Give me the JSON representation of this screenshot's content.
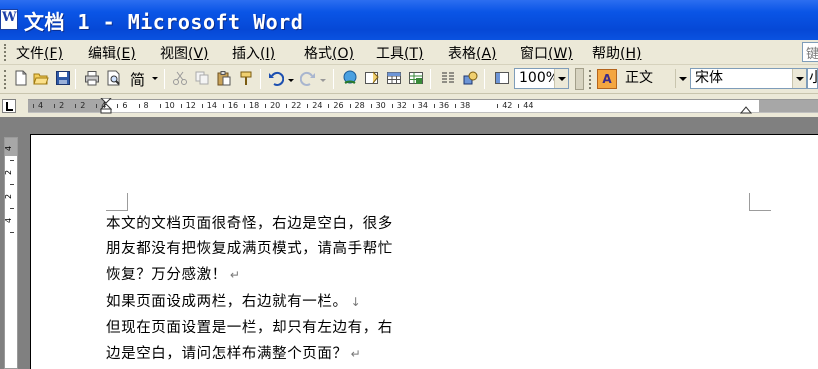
{
  "window": {
    "title": "文档 1 - Microsoft Word"
  },
  "menu": {
    "items": [
      {
        "label": "文件",
        "accel": "(F)"
      },
      {
        "label": "编辑",
        "accel": "(E)"
      },
      {
        "label": "视图",
        "accel": "(V)"
      },
      {
        "label": "插入",
        "accel": "(I)"
      },
      {
        "label": "格式",
        "accel": "(O)"
      },
      {
        "label": "工具",
        "accel": "(T)"
      },
      {
        "label": "表格",
        "accel": "(A)"
      },
      {
        "label": "窗口",
        "accel": "(W)"
      },
      {
        "label": "帮助",
        "accel": "(H)"
      }
    ],
    "help_box_text": "键"
  },
  "toolbar": {
    "convert_label": "简",
    "zoom": "100%",
    "style": "正文",
    "font": "宋体",
    "style_swatch": "A",
    "size_partial": "小"
  },
  "ruler": {
    "numbers": [
      "4",
      "2",
      "2",
      "4",
      "6",
      "8",
      "10",
      "12",
      "14",
      "16",
      "18",
      "20",
      "22",
      "24",
      "26",
      "28",
      "30",
      "32",
      "34",
      "36",
      "38",
      "42",
      "44"
    ]
  },
  "vruler": {
    "numbers": [
      "4",
      "2",
      "2",
      "4"
    ]
  },
  "document": {
    "lines": [
      {
        "text": "本文的文档页面很奇怪，右边是空白，很多",
        "mark": ""
      },
      {
        "text": "朋友都没有把恢复成满页模式，请高手帮忙",
        "mark": ""
      },
      {
        "text": "恢复？万分感激！",
        "mark": "↵"
      },
      {
        "text": "如果页面设成两栏，右边就有一栏。",
        "mark": "↓"
      },
      {
        "text": "但现在页面设置是一栏，却只有左边有，右",
        "mark": ""
      },
      {
        "text": "边是空白，请问怎样布满整个页面？",
        "mark": "↵"
      }
    ]
  },
  "colors": {
    "titlebar": "#0a55e6",
    "chrome": "#ece9d8",
    "workspace": "#808080"
  }
}
